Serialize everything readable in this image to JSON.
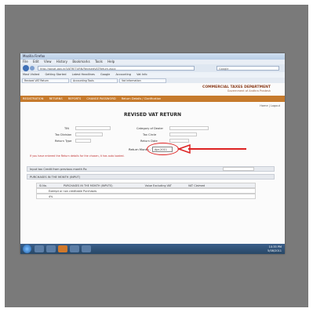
{
  "browser": {
    "title": "Mozilla Firefox",
    "menu": [
      "File",
      "Edit",
      "View",
      "History",
      "Bookmarks",
      "Tools",
      "Help"
    ],
    "url": "http://apvat.gov.in/VATRETURN/RevisedVATReturn.aspx",
    "search_placeholder": "Google",
    "bookmarks": [
      "Most Visited",
      "Getting Started",
      "Latest Headlines",
      "Google",
      "Accounting",
      "Vat Info"
    ],
    "tabs": [
      "Revised VAT Return",
      "Accounting Tools",
      "Vat Information"
    ]
  },
  "site": {
    "department": "COMMERCIAL TAXES DEPARTMENT",
    "department_sub": "Government of Andhra Pradesh",
    "nav": [
      "REGISTRATION",
      "RETURNS",
      "REPORTS",
      "CHANGE PASSWORD",
      "Return Details / Clarification"
    ],
    "user_links": "Home | Logout"
  },
  "form": {
    "title": "REVISED VAT RETURN",
    "tin_label": "TIN",
    "category_label": "Category of Dealer",
    "tax_division_label": "Tax Division",
    "tax_circle_label": "Tax Circle",
    "return_type_label": "Return Type",
    "return_date_label": "Return Date",
    "return_month_label": "Return Month - Year",
    "return_month_value": "Apr-2011",
    "note": "If you have entered the Return details for the chosen, it has auto loaded.",
    "section1": "Input tax Credit from previous month Rs",
    "section2": "PURCHASES IN THE MONTH (INPUT)",
    "table_headers": [
      "Sl.No.",
      "PURCHASES IN THE MONTH (INPUTS)",
      "Value Excluding VAT",
      "VAT Claimed"
    ],
    "rows": [
      "Exempt or non creditable Purchases",
      "4%"
    ]
  },
  "taskbar": {
    "time": "10:35 PM",
    "date": "5/08/2011"
  },
  "colors": {
    "accent": "#c67a2c",
    "highlight": "#d22222",
    "background": "#7a7a7a"
  }
}
